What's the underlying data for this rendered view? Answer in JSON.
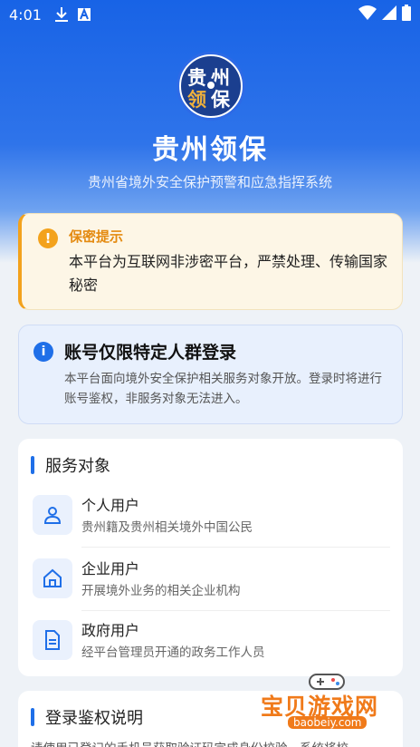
{
  "status_bar": {
    "time": "4:01"
  },
  "app": {
    "logo_chars": [
      "贵",
      "州",
      "领",
      "保"
    ],
    "title": "贵州领保",
    "subtitle": "贵州省境外安全保护预警和应急指挥系统"
  },
  "warning": {
    "icon": "!",
    "title": "保密提示",
    "text": "本平台为互联网非涉密平台，严禁处理、传输国家秘密"
  },
  "notice": {
    "icon": "i",
    "title": "账号仅限特定人群登录",
    "text": "本平台面向境外安全保护相关服务对象开放。登录时将进行账号鉴权，非服务对象无法进入。"
  },
  "services": {
    "title": "服务对象",
    "items": [
      {
        "icon": "person-icon",
        "name": "个人用户",
        "desc": "贵州籍及贵州相关境外中国公民"
      },
      {
        "icon": "building-icon",
        "name": "企业用户",
        "desc": "开展境外业务的相关企业机构"
      },
      {
        "icon": "document-icon",
        "name": "政府用户",
        "desc": "经平台管理员开通的政务工作人员"
      }
    ]
  },
  "auth": {
    "title": "登录鉴权说明",
    "text": "请使用已登记的手机号获取验证码完成身份校验，系统将校"
  },
  "watermark": {
    "title": "宝贝游戏网",
    "url": "baobeiy.com"
  },
  "colors": {
    "primary": "#1f6fe8",
    "warning": "#f3a21c",
    "header": "#1863e6"
  }
}
